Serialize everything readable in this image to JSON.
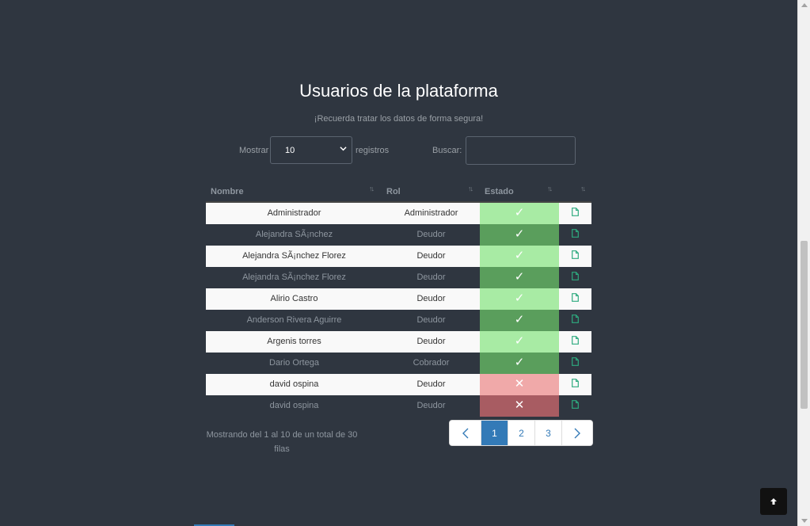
{
  "page": {
    "title": "Usuarios de la plataforma",
    "subtitle": "¡Recuerda tratar los datos de forma segura!"
  },
  "controls": {
    "show_label": "Mostrar",
    "show_value": "10",
    "records_label": "registros",
    "search_label": "Buscar:",
    "search_value": ""
  },
  "table": {
    "columns": [
      "Nombre",
      "Rol",
      "Estado",
      ""
    ],
    "rows": [
      {
        "name": "Administrador",
        "role": "Administrador",
        "state": "active"
      },
      {
        "name": "Alejandra SÃ¡nchez",
        "role": "Deudor",
        "state": "active"
      },
      {
        "name": "Alejandra SÃ¡nchez Florez",
        "role": "Deudor",
        "state": "active"
      },
      {
        "name": "Alejandra SÃ¡nchez Florez",
        "role": "Deudor",
        "state": "active"
      },
      {
        "name": "Alirio Castro",
        "role": "Deudor",
        "state": "active"
      },
      {
        "name": "Anderson Rivera Aguirre",
        "role": "Deudor",
        "state": "active"
      },
      {
        "name": "Argenis torres",
        "role": "Deudor",
        "state": "active"
      },
      {
        "name": "Dario Ortega",
        "role": "Cobrador",
        "state": "active"
      },
      {
        "name": "david ospina",
        "role": "Deudor",
        "state": "inactive"
      },
      {
        "name": "david ospina",
        "role": "Deudor",
        "state": "inactive"
      }
    ]
  },
  "state_symbols": {
    "active": "✓",
    "inactive": "✕"
  },
  "colors": {
    "active_light": "#a8eba4",
    "active_dark": "#5a9e5c",
    "inactive_light": "#f0a9a9",
    "inactive_dark": "#a85c62",
    "doc_icon": "#2eaa7f",
    "accent": "#337ab7"
  },
  "info": {
    "text": "Mostrando del 1 al 10 de un total de 30 filas"
  },
  "pagination": {
    "pages": [
      "1",
      "2",
      "3"
    ],
    "active": "1"
  },
  "icons": {
    "prev": "chevron-left-icon",
    "next": "chevron-right-icon",
    "document": "document-icon",
    "back_to_top": "arrow-up-icon"
  }
}
